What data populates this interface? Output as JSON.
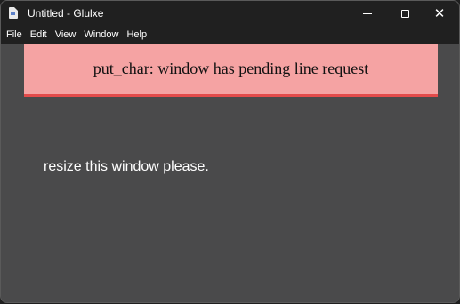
{
  "window": {
    "title": "Untitled - Glulxe",
    "app_icon": "document-icon"
  },
  "controls": {
    "minimize": "minimize-icon",
    "maximize": "maximize-icon",
    "close": "✕"
  },
  "menu": {
    "items": [
      "File",
      "Edit",
      "View",
      "Window",
      "Help"
    ]
  },
  "content": {
    "error_message": "put_char: window has pending line request",
    "body_text": "resize this window please."
  },
  "colors": {
    "error_background": "#f5a3a3",
    "error_border": "#e34b4b",
    "content_background": "#4a4a4b"
  }
}
